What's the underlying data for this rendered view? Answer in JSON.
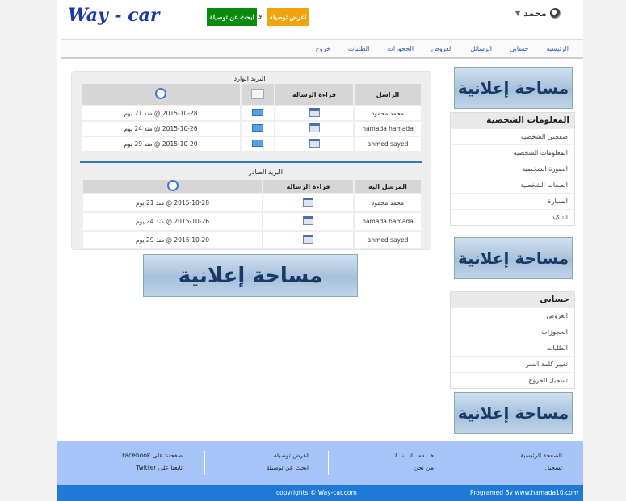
{
  "header": {
    "logo": "Way - car",
    "find_ride_btn": "ابحث عن توصيلة",
    "or": "أو",
    "offer_ride_btn": "اعرض توصيلة",
    "username": "محمد"
  },
  "nav": [
    "الرئيسية",
    "حسابى",
    "الرسائل",
    "العروض",
    "الحجوزات",
    "الطلبات",
    "خروج"
  ],
  "inbox": {
    "title": "البريد الوارد",
    "headers": {
      "sender": "الراسل",
      "read": "قراءة الرسالة"
    },
    "rows": [
      {
        "sender": "محمد محمود",
        "date": "2015-10-28 @ منذ 21 يوم"
      },
      {
        "sender": "hamada hamada",
        "date": "2015-10-26 @ منذ 24 يوم"
      },
      {
        "sender": "ahmed sayed",
        "date": "2015-10-20 @ منذ 29 يوم"
      }
    ]
  },
  "outbox": {
    "title": "البريد الصادر",
    "headers": {
      "recipient": "المرسل اليه",
      "read": "قراءة الرسالة"
    },
    "rows": [
      {
        "recipient": "محمد محمود",
        "date": "2015-10-28 @ منذ 21 يوم"
      },
      {
        "recipient": "hamada hamada",
        "date": "2015-10-26 @ منذ 24 يوم"
      },
      {
        "recipient": "ahmed sayed",
        "date": "2015-10-20 @ منذ 29 يوم"
      }
    ]
  },
  "ad_text": "مساحة إعلانية",
  "personal_panel": {
    "title": "المعلومات الشخصية",
    "items": [
      "صفحتى الشخصية",
      "المعلومات الشخصية",
      "الصورة الشخصية",
      "الصفات الشخصية",
      "السيارة",
      "التأكيد"
    ]
  },
  "account_panel": {
    "title": "حسابى",
    "items": [
      "العروض",
      "الحجوزات",
      "الطلبات",
      "تغيير كلمة السر",
      "تسجيل الخروج"
    ]
  },
  "footer": {
    "col1": [
      "الصفحة الرئيسية",
      "تسجيل"
    ],
    "col2": [
      "خـــدمـــاتـــنـــا",
      "من نحن"
    ],
    "col3": [
      "اعرض توصيلة",
      "ابحث عن توصيلة"
    ],
    "col4": [
      "صفحتنا على Facebook",
      "تابعنا على Twitter"
    ],
    "copyright": "copyrights © Way-car.com",
    "programmed": "Programed By www.hamada10.com"
  },
  "colors": {
    "accent": "#1f7ad6",
    "green": "#0a8a0a",
    "orange": "#f2a20d",
    "logo": "#1a3aa8"
  }
}
